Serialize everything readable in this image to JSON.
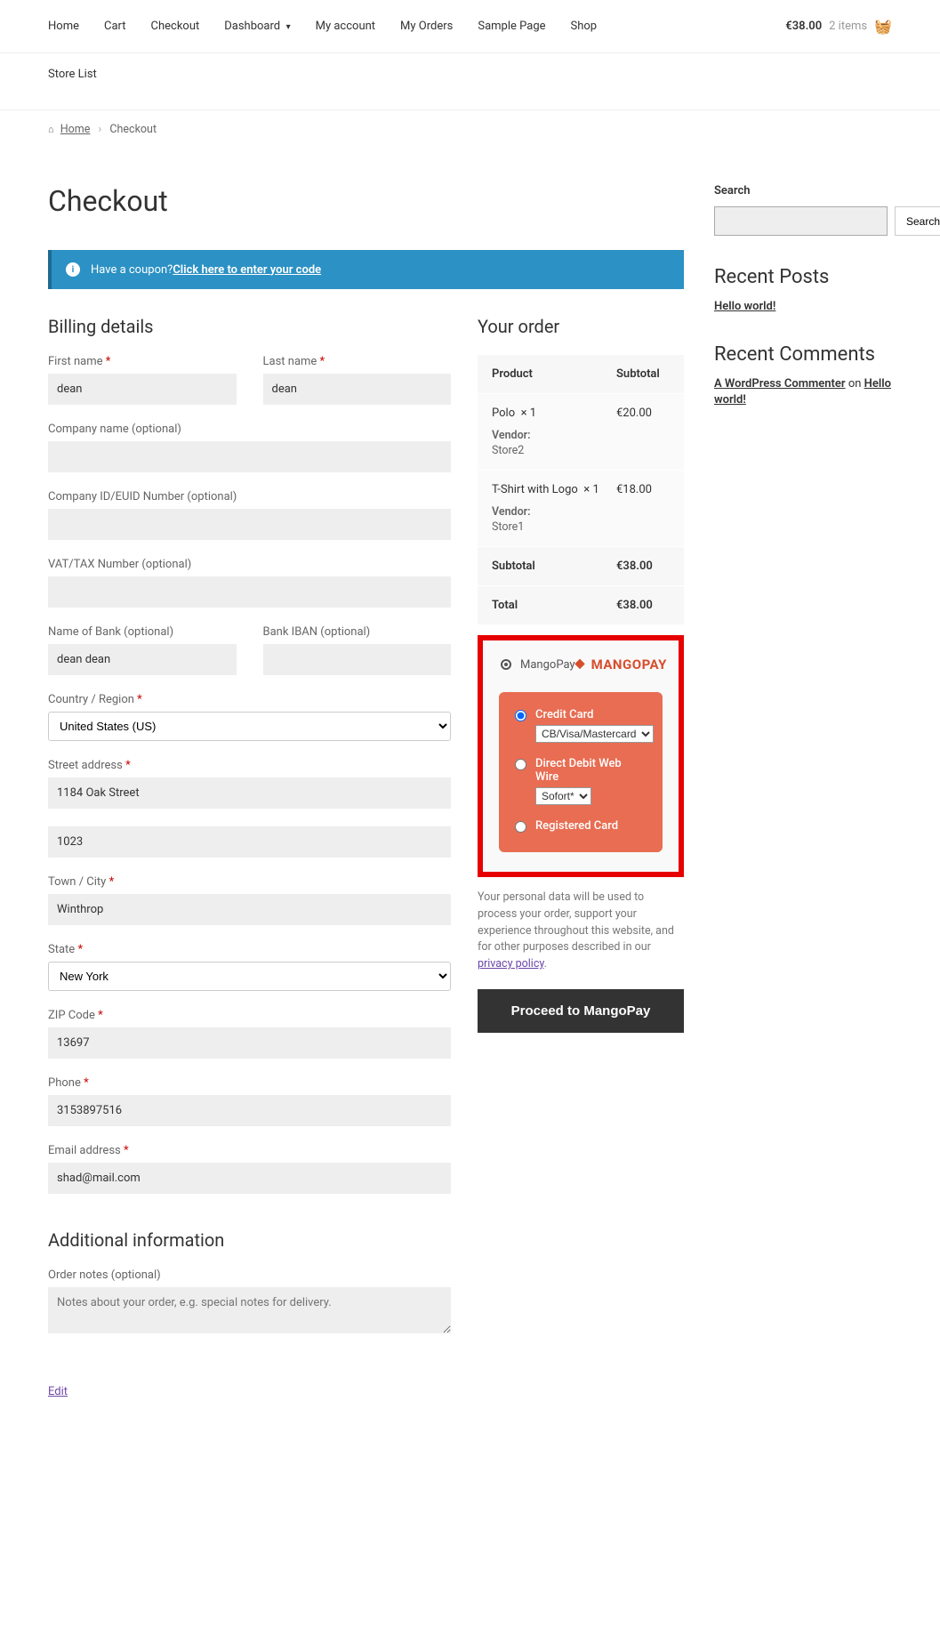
{
  "nav": {
    "items": [
      "Home",
      "Cart",
      "Checkout",
      "Dashboard",
      "My account",
      "My Orders",
      "Sample Page",
      "Shop"
    ],
    "row2": [
      "Store List"
    ],
    "cart_price": "€38.00",
    "cart_items": "2 items"
  },
  "breadcrumb": {
    "home": "Home",
    "current": "Checkout"
  },
  "page_title": "Checkout",
  "coupon": {
    "text": "Have a coupon? ",
    "link": "Click here to enter your code"
  },
  "billing": {
    "heading": "Billing details",
    "first_name_label": "First name",
    "first_name": "dean",
    "last_name_label": "Last name",
    "last_name": "dean",
    "company_label": "Company name (optional)",
    "company": "",
    "company_id_label": "Company ID/EUID Number (optional)",
    "company_id": "",
    "vat_label": "VAT/TAX Number (optional)",
    "vat": "",
    "bank_name_label": "Name of Bank (optional)",
    "bank_name": "dean dean",
    "bank_iban_label": "Bank IBAN (optional)",
    "bank_iban": "",
    "country_label": "Country / Region",
    "country": "United States (US)",
    "street_label": "Street address",
    "street1": "1184 Oak Street",
    "street2": "1023",
    "town_label": "Town / City",
    "town": "Winthrop",
    "state_label": "State",
    "state": "New York",
    "zip_label": "ZIP Code",
    "zip": "13697",
    "phone_label": "Phone",
    "phone": "3153897516",
    "email_label": "Email address",
    "email": "shad@mail.com"
  },
  "additional": {
    "heading": "Additional information",
    "notes_label": "Order notes (optional)",
    "notes_placeholder": "Notes about your order, e.g. special notes for delivery."
  },
  "edit_label": "Edit",
  "order": {
    "heading": "Your order",
    "col_product": "Product",
    "col_subtotal": "Subtotal",
    "items": [
      {
        "name": "Polo",
        "qty": "× 1",
        "subtotal": "€20.00",
        "vendor_label": "Vendor:",
        "vendor": "Store2"
      },
      {
        "name": "T-Shirt with Logo",
        "qty": "× 1",
        "subtotal": "€18.00",
        "vendor_label": "Vendor:",
        "vendor": "Store1"
      }
    ],
    "subtotal_label": "Subtotal",
    "subtotal": "€38.00",
    "total_label": "Total",
    "total": "€38.00"
  },
  "payment": {
    "method_name": "MangoPay",
    "logo_text": "MANGOPAY",
    "credit_card_label": "Credit Card",
    "credit_card_option": "CB/Visa/Mastercard",
    "direct_debit_label": "Direct Debit Web Wire",
    "direct_debit_option": "Sofort*",
    "registered_card_label": "Registered Card",
    "privacy_text": "Your personal data will be used to process your order, support your experience throughout this website, and for other purposes described in our ",
    "privacy_link": "privacy policy",
    "proceed": "Proceed to MangoPay"
  },
  "sidebar": {
    "search_label": "Search",
    "search_button": "Search",
    "recent_posts_heading": "Recent Posts",
    "recent_post": "Hello world!",
    "recent_comments_heading": "Recent Comments",
    "commenter": "A WordPress Commenter",
    "on": " on ",
    "comment_post": "Hello world!"
  }
}
